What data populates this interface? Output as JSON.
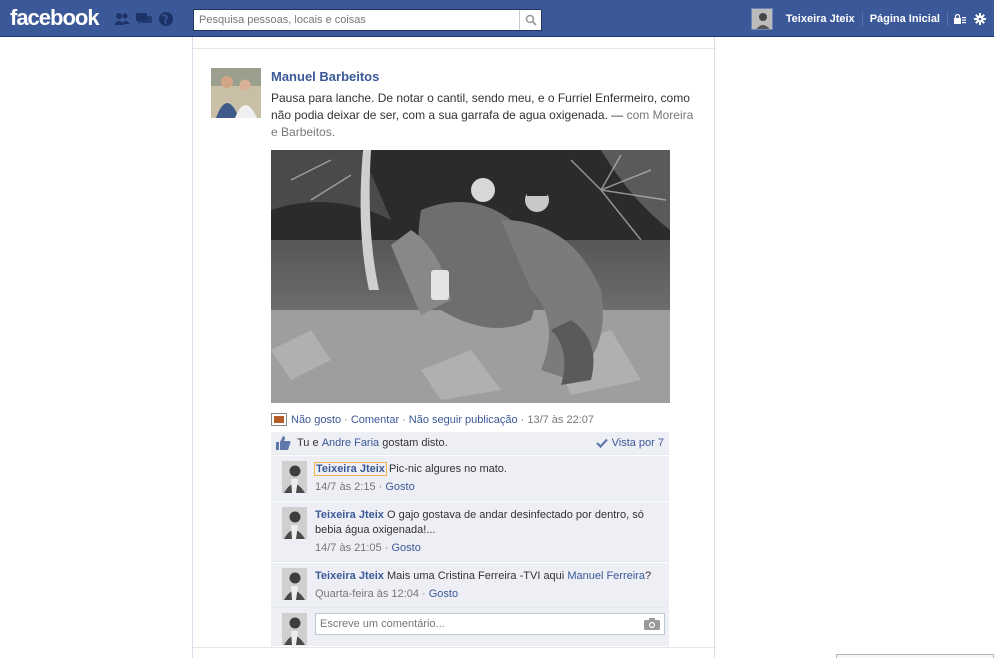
{
  "header": {
    "logo": "facebook",
    "search_placeholder": "Pesquisa pessoas, locais e coisas",
    "user_name": "Teixeira Jteix",
    "home_label": "Página Inicial",
    "jewels": [
      "friends-icon",
      "messages-icon",
      "notifications-globe-icon"
    ]
  },
  "post": {
    "author": "Manuel Barbeitos",
    "text": "Pausa para lanche. De notar o cantil, sendo meu, e o Furriel Enfermeiro, como não podia deixar de ser, com a sua garrafa de agua oxigenada. —",
    "with_prefix": "com",
    "with_name_1": "Moreira",
    "with_and": "e",
    "with_name_2": "Barbeitos",
    "with_suffix": ".",
    "photo_description": "black-and-white photo of two soldiers resting in the bush",
    "actions": {
      "unlike": "Não gosto",
      "comment": "Comentar",
      "unfollow": "Não seguir publicação",
      "timestamp": "13/7 às 22:07"
    },
    "likes": {
      "you": "Tu",
      "and": "e",
      "friend": "Andre Faria",
      "suffix": "gostam disto.",
      "seen_by": "Vista por 7"
    },
    "comments": [
      {
        "author": "Teixeira Jteix",
        "text": "Pic-nic algures no mato.",
        "time": "14/7 às 2:15",
        "like": "Gosto"
      },
      {
        "author": "Teixeira Jteix",
        "text": "O gajo gostava de andar desinfectado por dentro, só bebia água oxigenada!...",
        "time": "14/7 às 21:05",
        "like": "Gosto"
      },
      {
        "author": "Teixeira Jteix",
        "text": "Mais uma Cristina Ferreira -TVI aqui",
        "mention": "Manuel Ferreira",
        "tail": "?",
        "time": "Quarta-feira às 12:04",
        "like": "Gosto"
      }
    ],
    "reply_placeholder": "Escreve um comentário..."
  },
  "colors": {
    "brand": "#3b5998",
    "ufi_bg": "#edeff4",
    "link": "#3b5998"
  }
}
